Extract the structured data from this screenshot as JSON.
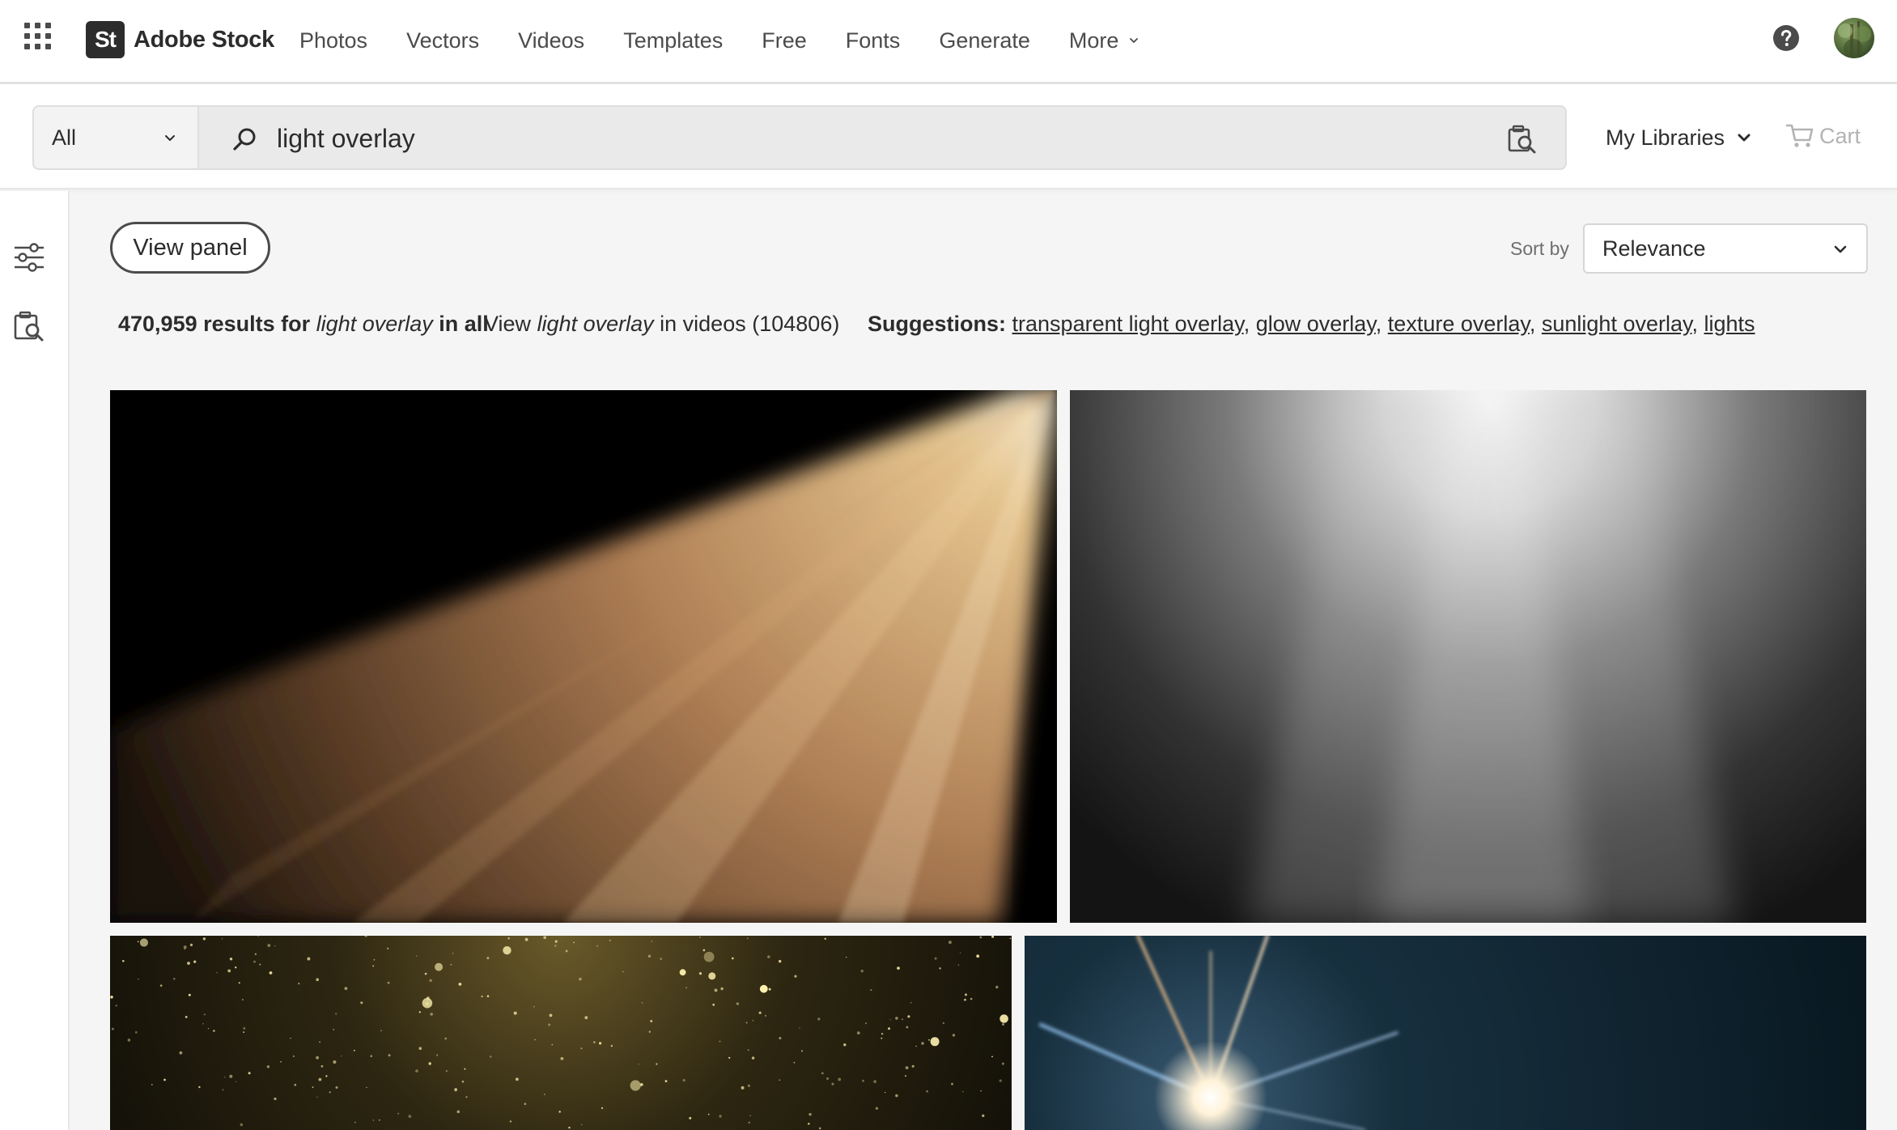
{
  "brand": {
    "badge": "St",
    "name": "Adobe Stock"
  },
  "nav": {
    "links": [
      "Photos",
      "Vectors",
      "Videos",
      "Templates",
      "Free",
      "Fonts",
      "Generate"
    ],
    "more_label": "More"
  },
  "search": {
    "scope": "All",
    "query": "light overlay"
  },
  "header_actions": {
    "libraries_label": "My Libraries",
    "cart_label": "Cart"
  },
  "toolbar": {
    "view_panel_label": "View panel",
    "sort_label": "Sort by",
    "sort_value": "Relevance"
  },
  "results": {
    "count": "470,959",
    "results_for": "results for",
    "term": "light overlay",
    "in_label": "in all",
    "view_label": "View",
    "videos_term": "light overlay",
    "videos_suffix": "in videos",
    "videos_count": "(104806)"
  },
  "suggestions": {
    "label": "Suggestions:",
    "items": [
      "transparent light overlay",
      "glow overlay",
      "texture overlay",
      "sunlight overlay",
      "lights"
    ]
  },
  "tiles": [
    {
      "name": "golden-light-rays-image"
    },
    {
      "name": "white-spotlight-fog-image"
    },
    {
      "name": "golden-glitter-particles-image"
    },
    {
      "name": "lens-flare-star-image"
    }
  ],
  "colors": {
    "text": "#2c2c2c",
    "muted": "#6e6e6e",
    "badge_bg": "#2c2c2c",
    "page_bg": "#f5f5f5"
  }
}
